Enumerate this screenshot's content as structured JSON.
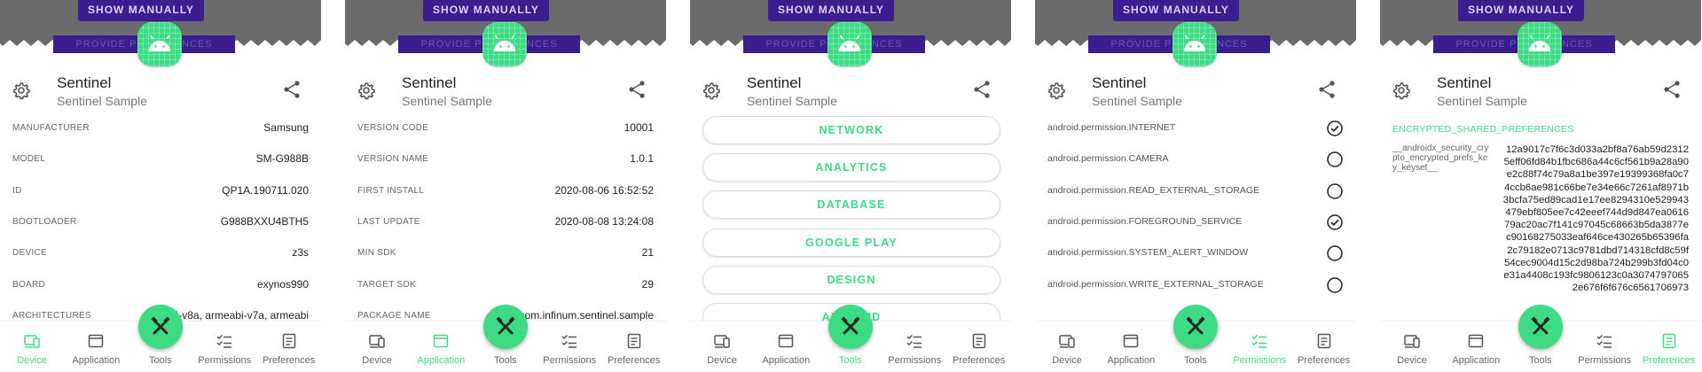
{
  "app": {
    "top_button_label": "SHOW MANUALLY",
    "behind_button_label": "PROVIDE PREFERENCES",
    "title": "Sentinel",
    "subtitle": "Sentinel Sample"
  },
  "colors": {
    "accent": "#3ddc84",
    "top_gray": "#6b6b6b",
    "purple": "#3b1d8f"
  },
  "nav": {
    "items": [
      {
        "label": "Device",
        "icon": "device-icon"
      },
      {
        "label": "Application",
        "icon": "application-icon"
      },
      {
        "label": "Tools",
        "icon": "tools-icon"
      },
      {
        "label": "Permissions",
        "icon": "permissions-icon"
      },
      {
        "label": "Preferences",
        "icon": "preferences-icon"
      }
    ]
  },
  "screens": [
    {
      "active_tab": "Device",
      "rows": [
        {
          "label": "MANUFACTURER",
          "value": "Samsung"
        },
        {
          "label": "MODEL",
          "value": "SM-G988B"
        },
        {
          "label": "ID",
          "value": "QP1A.190711.020"
        },
        {
          "label": "BOOTLOADER",
          "value": "G988BXXU4BTH5"
        },
        {
          "label": "DEVICE",
          "value": "z3s"
        },
        {
          "label": "BOARD",
          "value": "exynos990"
        },
        {
          "label": "ARCHITECTURES",
          "value": "arm64-v8a, armeabi-v7a, armeabi"
        }
      ]
    },
    {
      "active_tab": "Application",
      "rows": [
        {
          "label": "VERSION CODE",
          "value": "10001"
        },
        {
          "label": "VERSION NAME",
          "value": "1.0.1"
        },
        {
          "label": "FIRST INSTALL",
          "value": "2020-08-06 16:52:52"
        },
        {
          "label": "LAST UPDATE",
          "value": "2020-08-08 13:24:08"
        },
        {
          "label": "MIN SDK",
          "value": "21"
        },
        {
          "label": "TARGET SDK",
          "value": "29"
        },
        {
          "label": "PACKAGE NAME",
          "value": "com.infinum.sentinel.sample"
        }
      ]
    },
    {
      "active_tab": "Tools",
      "buttons": [
        "NETWORK",
        "ANALYTICS",
        "DATABASE",
        "GOOGLE PLAY",
        "DESIGN",
        "ANDROID"
      ]
    },
    {
      "active_tab": "Permissions",
      "permissions": [
        {
          "name": "android.permission.INTERNET",
          "granted": true
        },
        {
          "name": "android.permission.CAMERA",
          "granted": false
        },
        {
          "name": "android.permission.READ_EXTERNAL_STORAGE",
          "granted": false
        },
        {
          "name": "android.permission.FOREGROUND_SERVICE",
          "granted": true
        },
        {
          "name": "android.permission.SYSTEM_ALERT_WINDOW",
          "granted": false
        },
        {
          "name": "android.permission.WRITE_EXTERNAL_STORAGE",
          "granted": false
        }
      ]
    },
    {
      "active_tab": "Preferences",
      "section_title": "ENCRYPTED_SHARED_PREFERENCES",
      "key": "__androidx_security_crypto_encrypted_prefs_key_keyset__",
      "value": "12a9017c7f6c3d033a2bf8a76ab59d23125eff06fd84b1fbc686a44c6cf561b9a28a90e2c88f74c79a8a1be397e19399368fa0c74ccb6ae981c66be7e34e66c7261af8971b3bcfa75ed89cad1e17ee8294310e529943479ebf805ee7c42eeef744d9d847ea061679ac20ac7f141c97045c68663b5da3877ec90168275033eaf646ce430265b65396fa2c79182e0713c9781dbd714318cfd8c59f54cec9004d15c2d98ba724b299b3fd04c0e31a4408c193fc9806123c0a30747970652e676f6f676c6561706973"
    }
  ]
}
